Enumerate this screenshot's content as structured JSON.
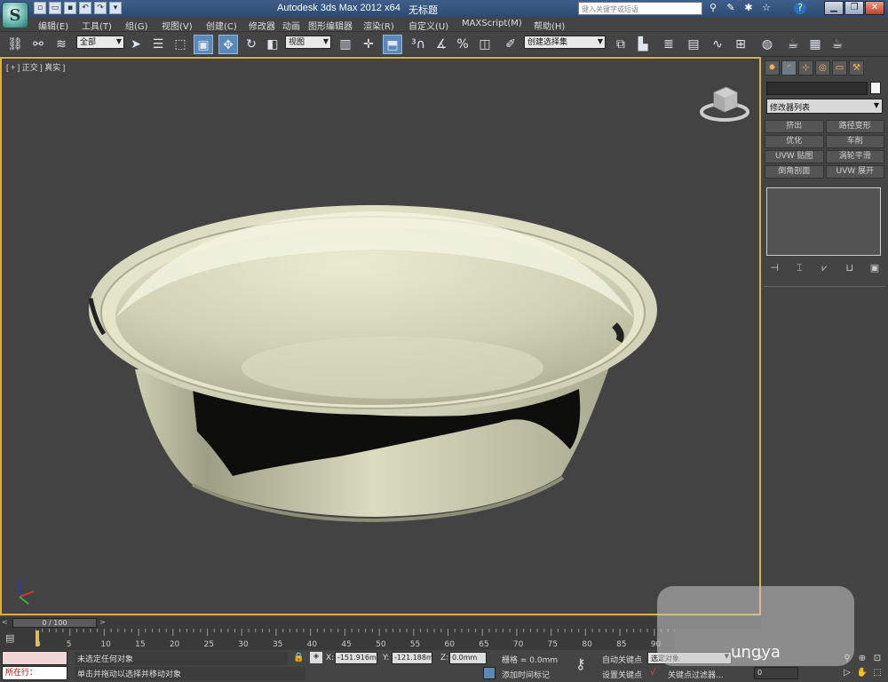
{
  "titlebar": {
    "app_title": "Autodesk 3ds Max  2012 x64",
    "doc_name": "无标题",
    "search_placeholder": "键入关键字或短语",
    "app_logo": "S",
    "qa_icons": [
      "new-file-icon",
      "open-folder-icon",
      "save-icon",
      "undo-icon",
      "redo-icon",
      "dropdown-icon"
    ],
    "title_icons": [
      "binoculars-icon",
      "tools-icon",
      "star-icon",
      "favorite-star-icon",
      "help-icon"
    ],
    "window_controls": [
      "minimize-icon",
      "restore-icon",
      "close-icon"
    ]
  },
  "menu": {
    "items": [
      "编辑(E)",
      "工具(T)",
      "组(G)",
      "视图(V)",
      "创建(C)",
      "修改器",
      "动画",
      "图形编辑器",
      "渲染(R)",
      "自定义(U)",
      "MAXScript(M)",
      "帮助(H)"
    ]
  },
  "toolbar": {
    "selection_filter": "全部",
    "ref_coord": "视图",
    "named_selection": "创建选择集",
    "accent_color": "#5a88b8"
  },
  "viewport": {
    "label": "[ + ] 正交 ] 真实 ]",
    "border_color": "#d8b243"
  },
  "command_panel": {
    "modifier_list": "修改器列表",
    "buttons": [
      "挤出",
      "路径变形",
      "优化",
      "车削",
      "UVW 贴图",
      "涡轮平滑",
      "倒角剖面",
      "UVW 展开"
    ]
  },
  "timeline": {
    "slider_label": "0 / 100",
    "ticks": [
      "0",
      "5",
      "10",
      "15",
      "20",
      "25",
      "30",
      "35",
      "40",
      "45",
      "50",
      "55",
      "60",
      "65",
      "70",
      "75",
      "80",
      "85",
      "90"
    ]
  },
  "status": {
    "current_label": "所在行：",
    "selection_status": "未选定任何对象",
    "prompt": "单击并拖动以选择并移动对象",
    "x_label": "X:",
    "x_value": "-151.916m",
    "y_label": "Y:",
    "y_value": "-121.188m",
    "z_label": "Z:",
    "z_value": "0.0mm",
    "grid": "栅格 = 0.0mm",
    "add_tag": "添加时间标记",
    "auto_key": "自动关键点",
    "set_key": "设置关键点",
    "selected_option": "选定对象",
    "key_filters": "关键点过滤器...",
    "frame_value": "0"
  },
  "watermark": "ungya"
}
